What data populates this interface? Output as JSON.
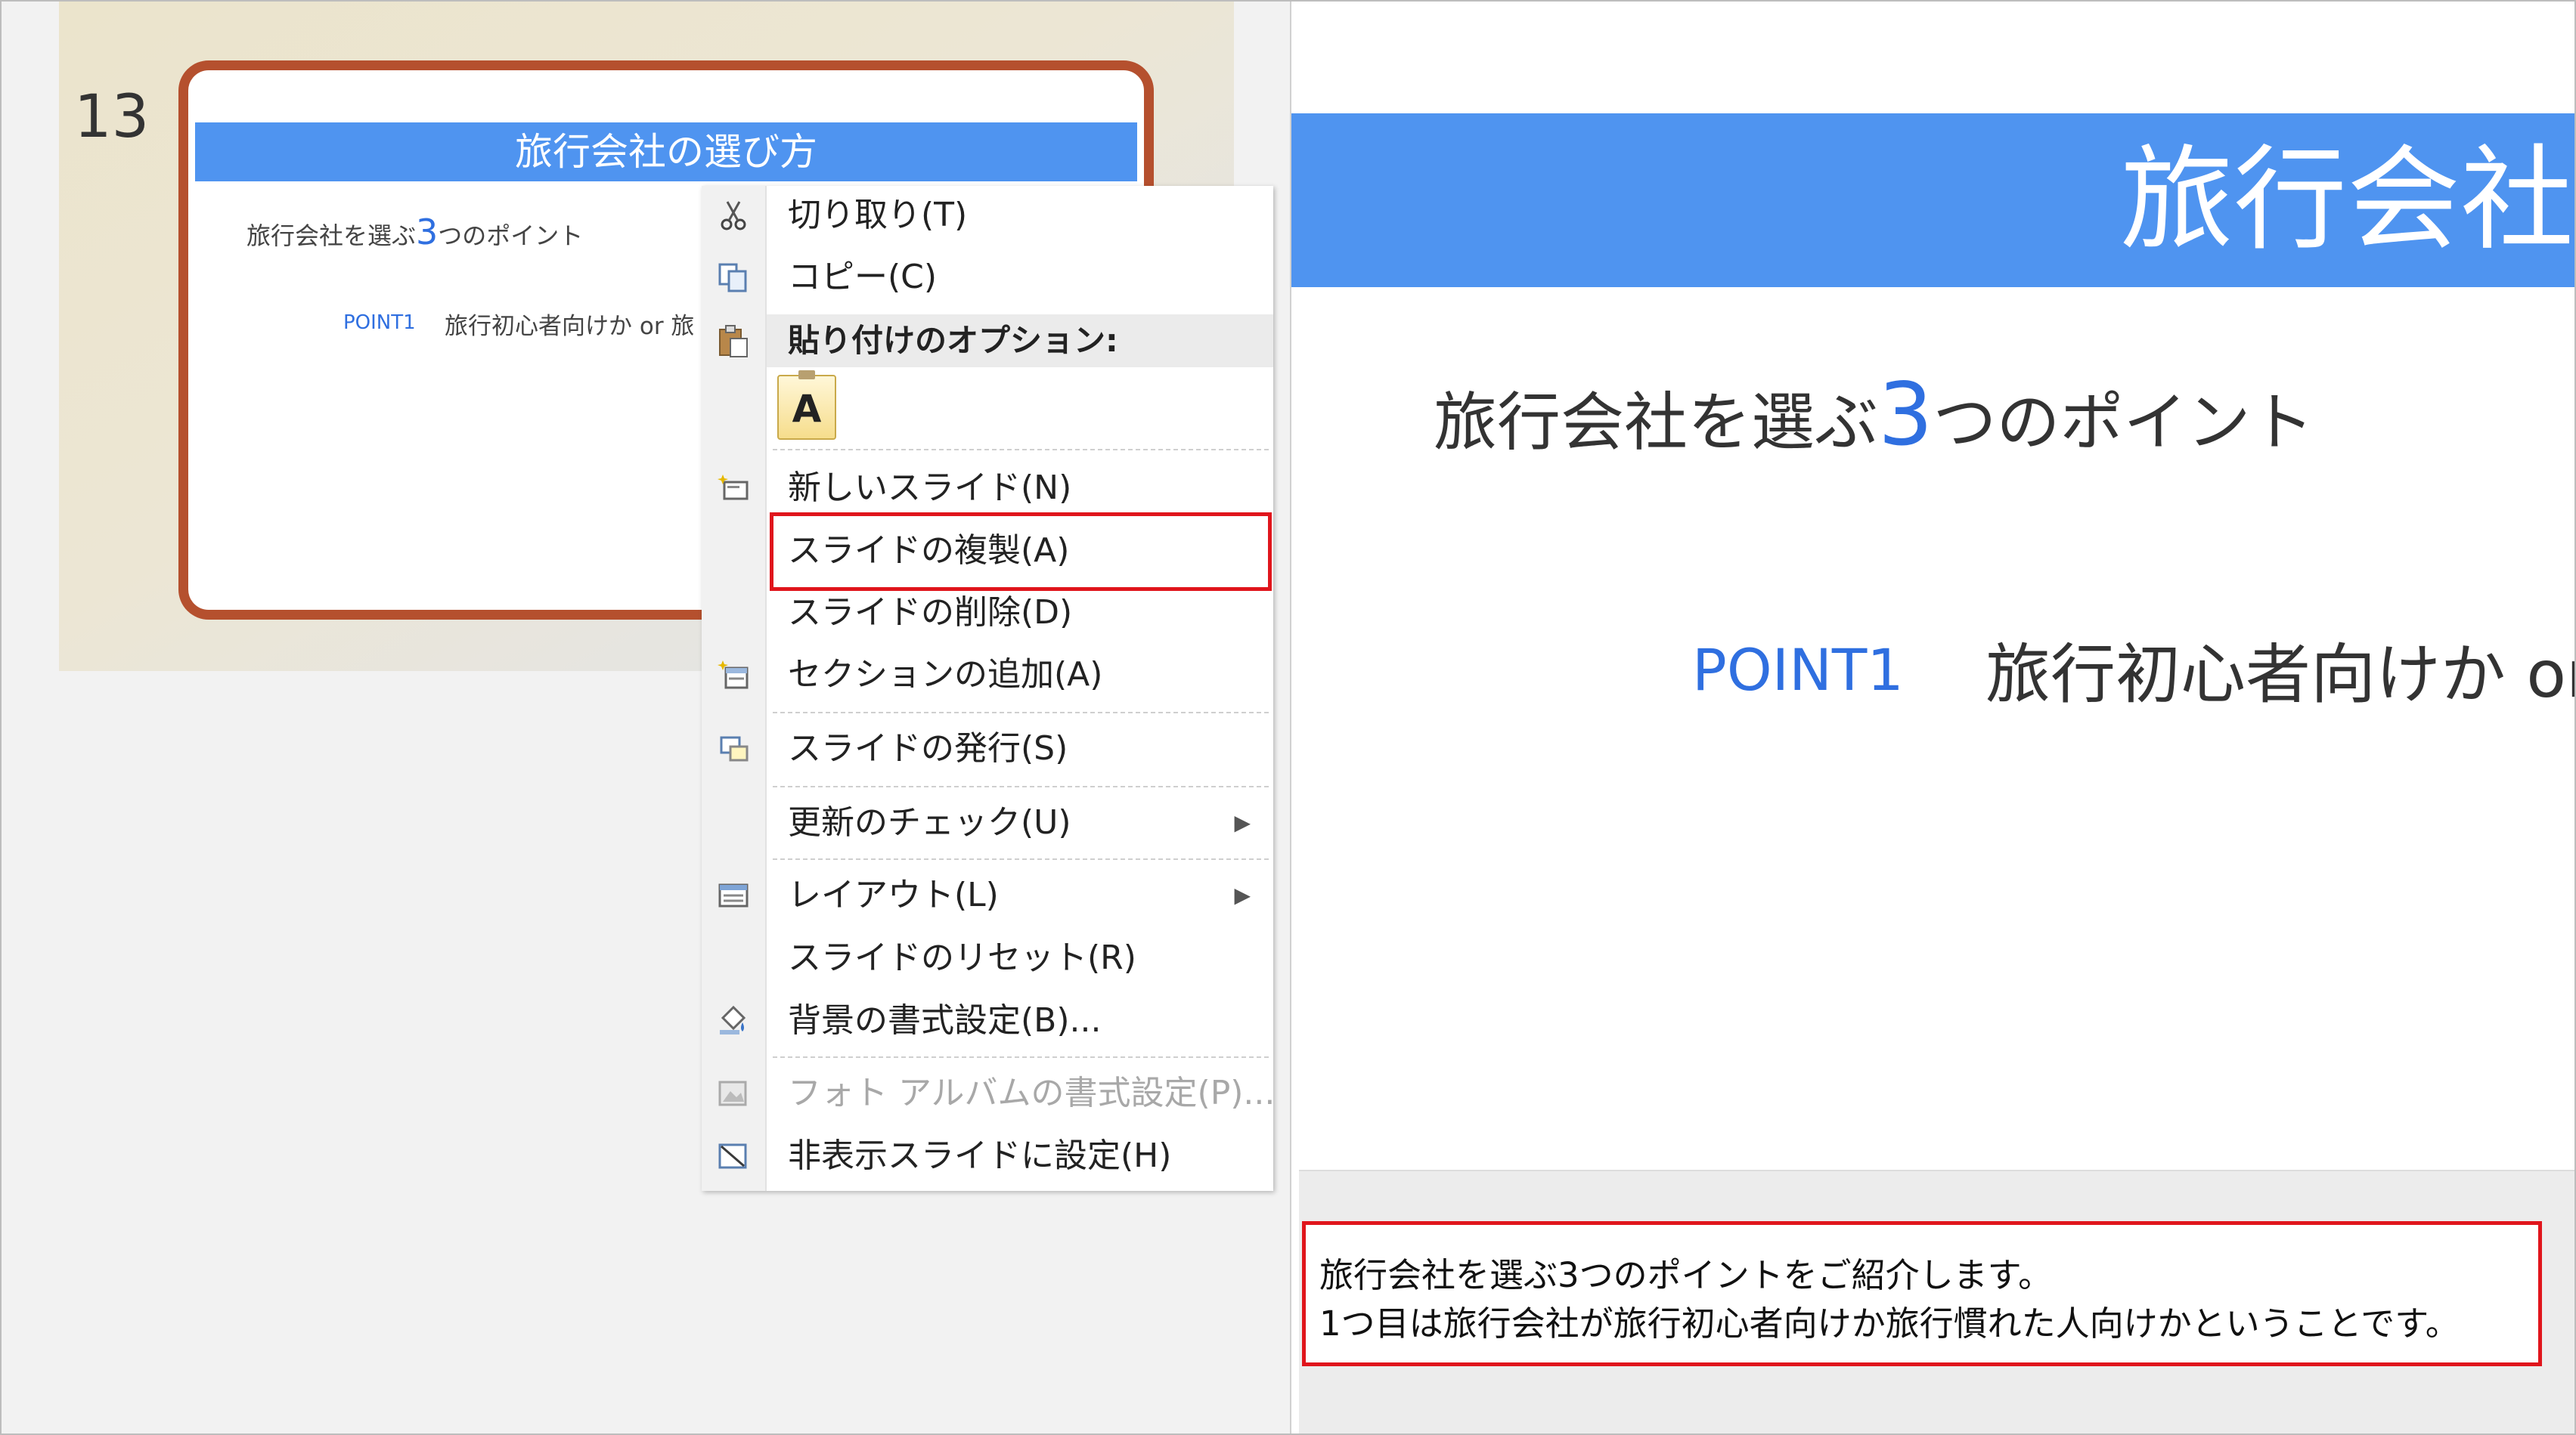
{
  "slide_number": "13",
  "slide": {
    "title": "旅行会社の選び方",
    "subtitle_before": "旅行会社を選ぶ",
    "subtitle_accent": "3",
    "subtitle_after": "つのポイント",
    "point_label": "POINT1",
    "point_text": "旅行初心者向けか or",
    "thumb_point_text": "旅行初心者向けか or 旅"
  },
  "context_menu": {
    "items": [
      {
        "label": "切り取り(T)",
        "icon": "scissors-icon"
      },
      {
        "label": "コピー(C)",
        "icon": "copy-icon"
      },
      {
        "label": "貼り付けのオプション:",
        "icon": "paste-icon"
      },
      {
        "label": "A",
        "icon": "paste-keep-text-icon"
      },
      {
        "label": "新しいスライド(N)",
        "icon": "new-slide-icon"
      },
      {
        "label": "スライドの複製(A)",
        "icon": ""
      },
      {
        "label": "スライドの削除(D)",
        "icon": ""
      },
      {
        "label": "セクションの追加(A)",
        "icon": "add-section-icon"
      },
      {
        "label": "スライドの発行(S)",
        "icon": "publish-slide-icon"
      },
      {
        "label": "更新のチェック(U)",
        "icon": ""
      },
      {
        "label": "レイアウト(L)",
        "icon": "layout-icon"
      },
      {
        "label": "スライドのリセット(R)",
        "icon": ""
      },
      {
        "label": "背景の書式設定(B)...",
        "icon": "format-background-icon"
      },
      {
        "label": "フォト アルバムの書式設定(P)...",
        "icon": "photo-album-icon"
      },
      {
        "label": "非表示スライドに設定(H)",
        "icon": "hide-slide-icon"
      }
    ],
    "submenu_arrow": "▶"
  },
  "notes": {
    "line1": "旅行会社を選ぶ3つのポイントをご紹介します。",
    "line2": "1つ目は旅行会社が旅行初心者向けか旅行慣れた人向けかということです。"
  },
  "colors": {
    "title_bar": "#4f94f0",
    "accent_text": "#2f6fe0",
    "highlight_border": "#e0151c",
    "thumb_border": "#b5502e"
  }
}
